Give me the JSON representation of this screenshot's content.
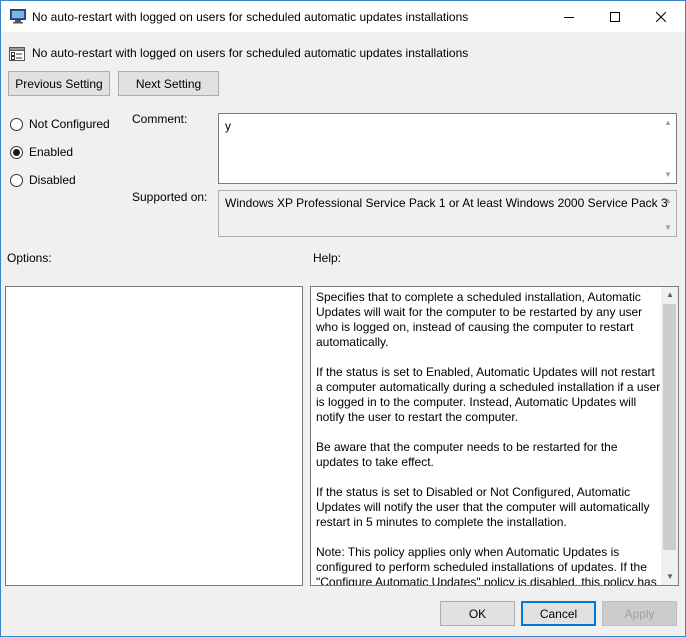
{
  "window": {
    "title": "No auto-restart with logged on users for scheduled automatic updates installations",
    "controls": {
      "minimize_icon": "minimize-icon",
      "maximize_icon": "maximize-icon",
      "close_icon": "close-icon"
    }
  },
  "policy": {
    "heading": "No auto-restart with logged on users for scheduled automatic updates installations"
  },
  "nav": {
    "previous_label": "Previous Setting",
    "next_label": "Next Setting"
  },
  "state": {
    "options": [
      {
        "label": "Not Configured",
        "checked": false
      },
      {
        "label": "Enabled",
        "checked": true
      },
      {
        "label": "Disabled",
        "checked": false
      }
    ]
  },
  "comment": {
    "label": "Comment:",
    "value": "y"
  },
  "supported": {
    "label": "Supported on:",
    "value": "Windows XP Professional Service Pack 1 or At least Windows 2000 Service Pack 3"
  },
  "sections": {
    "options_label": "Options:",
    "help_label": "Help:"
  },
  "help": {
    "paragraphs": [
      "Specifies that to complete a scheduled installation, Automatic Updates will wait for the computer to be restarted by any user who is logged on, instead of causing the computer to restart automatically.",
      "If the status is set to Enabled, Automatic Updates will not restart a computer automatically during a scheduled installation if a user is logged in to the computer. Instead, Automatic Updates will notify the user to restart the computer.",
      "Be aware that the computer needs to be restarted for the updates to take effect.",
      "If the status is set to Disabled or Not Configured, Automatic Updates will notify the user that the computer will automatically restart in 5 minutes to complete the installation.",
      "Note: This policy applies only when Automatic Updates is configured to perform scheduled installations of updates. If the \"Configure Automatic Updates\" policy is disabled, this policy has no effect."
    ]
  },
  "footer": {
    "ok_label": "OK",
    "cancel_label": "Cancel",
    "apply_label": "Apply"
  },
  "colors": {
    "accent": "#0078d7",
    "window_border": "#3c82c9",
    "dialog_bg": "#f0f0f0"
  }
}
